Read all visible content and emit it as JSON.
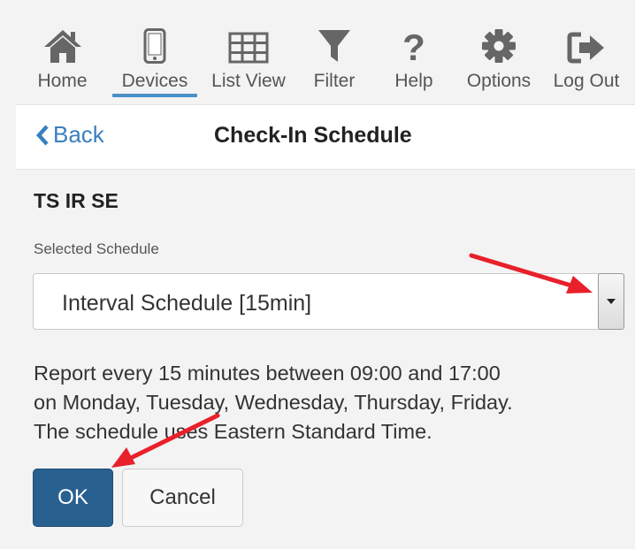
{
  "nav": {
    "items": [
      {
        "label": "Home",
        "icon": "home-icon"
      },
      {
        "label": "Devices",
        "icon": "phone-icon",
        "active": true
      },
      {
        "label": "List View",
        "icon": "grid-icon"
      },
      {
        "label": "Filter",
        "icon": "filter-icon"
      },
      {
        "label": "Help",
        "icon": "question-icon"
      },
      {
        "label": "Options",
        "icon": "gear-icon"
      },
      {
        "label": "Log Out",
        "icon": "logout-icon"
      }
    ]
  },
  "header": {
    "back_label": "Back",
    "title": "Check-In Schedule"
  },
  "device": {
    "name": "TS IR SE"
  },
  "schedule": {
    "label": "Selected Schedule",
    "selected_value": "Interval Schedule [15min]"
  },
  "description": {
    "line1": "Report every 15 minutes between 09:00 and 17:00",
    "line2": "on Monday, Tuesday, Wednesday, Thursday, Friday.",
    "line3": "The schedule uses Eastern Standard Time."
  },
  "actions": {
    "ok_label": "OK",
    "cancel_label": "Cancel"
  },
  "colors": {
    "accent": "#3a7fc0",
    "primary_button": "#286090",
    "annotation_arrow": "#e8202a"
  }
}
